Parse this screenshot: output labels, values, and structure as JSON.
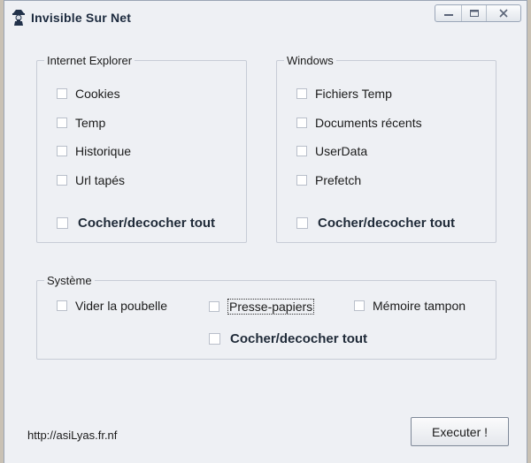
{
  "window": {
    "title": "Invisible Sur Net",
    "icon": "spy-app-icon",
    "controls": [
      "minimize-icon",
      "maximize-icon",
      "close-icon"
    ]
  },
  "groups": {
    "ie": {
      "legend": "Internet Explorer",
      "items": [
        "Cookies",
        "Temp",
        "Historique",
        "Url tapés"
      ],
      "toggle_all": "Cocher/decocher tout"
    },
    "windows": {
      "legend": "Windows",
      "items": [
        "Fichiers Temp",
        "Documents récents",
        "UserData",
        "Prefetch"
      ],
      "toggle_all": "Cocher/decocher tout"
    },
    "system": {
      "legend": "Système",
      "items": [
        "Vider la poubelle",
        "Presse-papiers",
        "Mémoire tampon"
      ],
      "toggle_all": "Cocher/decocher tout"
    }
  },
  "footer": {
    "url": "http://asiLyas.fr.nf",
    "execute_label": "Executer !"
  },
  "colors": {
    "window_bg": "#eef0f4",
    "title_text": "#1c2a3e",
    "group_border": "#c7ccd6"
  }
}
